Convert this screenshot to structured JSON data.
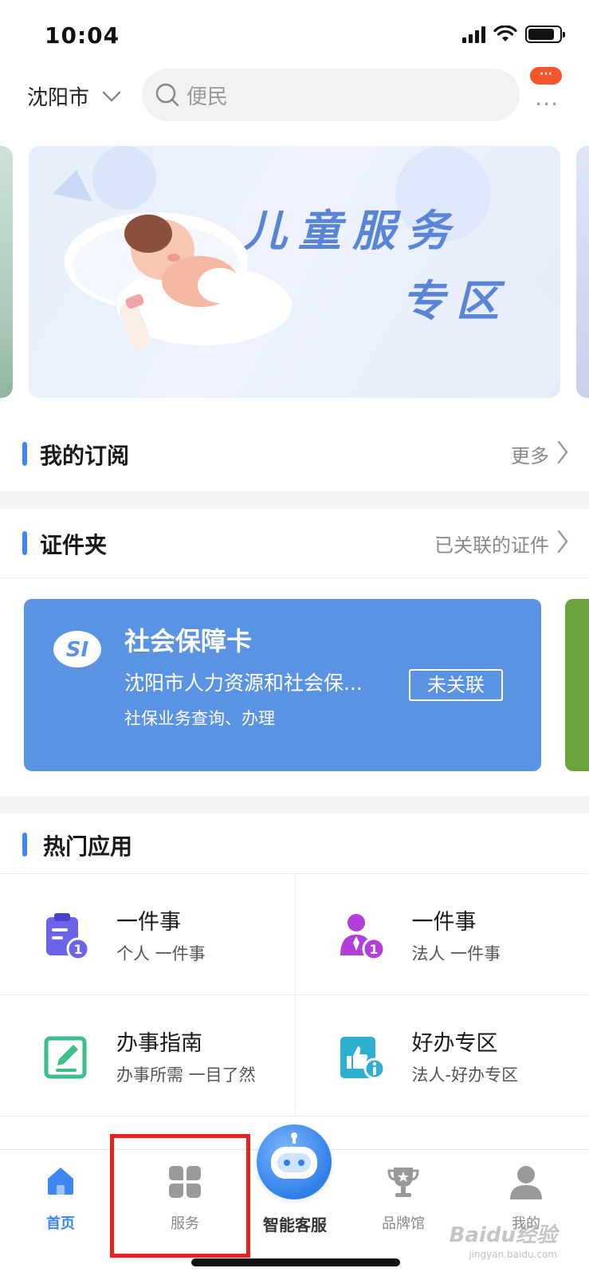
{
  "status_bar": {
    "time": "10:04",
    "battery_level": 0.85
  },
  "header": {
    "city": "沈阳市",
    "search_placeholder": "便民",
    "notify_badge": "···",
    "more_dots": "···"
  },
  "banner": {
    "title_line1": "儿童服务",
    "title_line2": "专区"
  },
  "subscription": {
    "title": "我的订阅",
    "link": "更多"
  },
  "cert_folder": {
    "title": "证件夹",
    "link": "已关联的证件",
    "card": {
      "logo_text": "SI",
      "title": "社会保障卡",
      "org": "沈阳市人力资源和社会保...",
      "desc": "社保业务查询、办理",
      "status": "未关联"
    }
  },
  "hot_apps": {
    "title": "热门应用",
    "items": [
      {
        "title": "一件事",
        "subtitle": "个人 一件事",
        "icon": "clipboard-person-icon",
        "color": "#6c63e8"
      },
      {
        "title": "一件事",
        "subtitle": "法人 一件事",
        "icon": "person-tie-icon",
        "color": "#b23fd9"
      },
      {
        "title": "办事指南",
        "subtitle": "办事所需 一目了然",
        "icon": "edit-document-icon",
        "color": "#3dbf8a"
      },
      {
        "title": "好办专区",
        "subtitle": "法人-好办专区",
        "icon": "thumbs-up-doc-icon",
        "color": "#2eaed1"
      }
    ]
  },
  "tabbar": {
    "tabs": [
      {
        "label": "首页",
        "icon": "home-icon",
        "active": true
      },
      {
        "label": "服务",
        "icon": "grid-petal-icon",
        "active": false
      },
      {
        "label": "智能客服",
        "icon": "robot-icon",
        "active": false
      },
      {
        "label": "品牌馆",
        "icon": "trophy-icon",
        "active": false
      },
      {
        "label": "我的",
        "icon": "user-icon",
        "active": false
      }
    ]
  },
  "watermark": {
    "text": "Baidu经验",
    "sub": "jingyan.baidu.com"
  },
  "colors": {
    "accent": "#3e86f5",
    "card_blue": "#5b93e4",
    "highlight_red": "#e8231f"
  }
}
